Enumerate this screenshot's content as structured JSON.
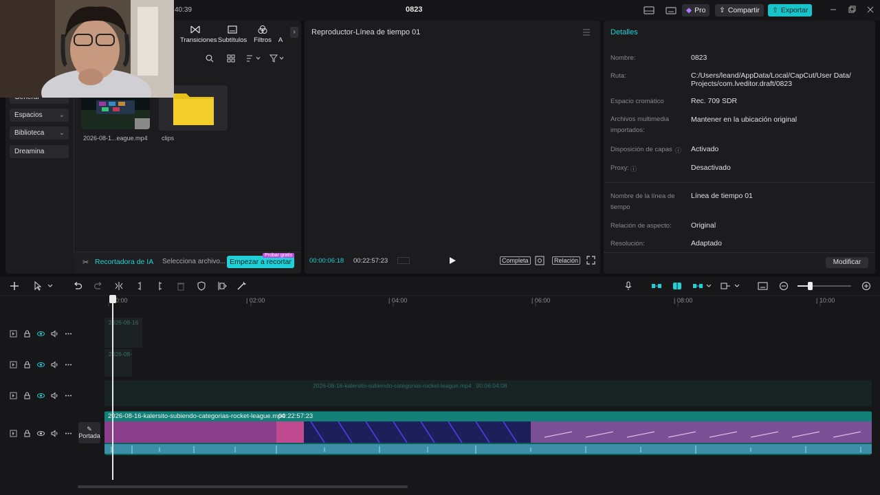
{
  "topbar": {
    "clock": "40:39",
    "project_name": "0823",
    "pro_label": "Pro",
    "share_label": "Compartir",
    "export_label": "Exportar"
  },
  "tools": {
    "tabs": [
      {
        "label": "Transiciones",
        "icon": "transitions-icon"
      },
      {
        "label": "Subtítulos",
        "icon": "subtitles-icon"
      },
      {
        "label": "Filtros",
        "icon": "filters-icon"
      },
      {
        "label": "A",
        "icon": "more-icon"
      }
    ]
  },
  "sidebar": {
    "items": [
      {
        "label": "General"
      },
      {
        "label": "Espacios"
      },
      {
        "label": "Biblioteca"
      },
      {
        "label": "Dreamina"
      }
    ]
  },
  "media": {
    "items": [
      {
        "label": "2026-08-1...eague.mp4"
      },
      {
        "label": "clips"
      }
    ]
  },
  "ai_bar": {
    "title": "Recortadora de IA",
    "select": "Selecciona archivo...",
    "button": "Empezar a recortar",
    "badge": "Probar gratis"
  },
  "player": {
    "title": "Reproductor-Línea de tiempo 01",
    "current_time": "00:00:06:18",
    "total_time": "00:22:57:23",
    "btn_full": "Completa",
    "btn_ratio": "Relación"
  },
  "details": {
    "title": "Detalles",
    "rows": [
      {
        "label": "Nombre:",
        "value": "0823"
      },
      {
        "label": "Ruta:",
        "value": "C:/Users/leand/AppData/Local/CapCut/User Data/ Projects/com.lveditor.draft/0823"
      },
      {
        "label": "Espacio cromático",
        "value": "Rec. 709 SDR"
      },
      {
        "label": "Archivos multimedia importados:",
        "value": "Mantener en la ubicación original"
      },
      {
        "label": "Disposición de capas",
        "value": "Activado"
      },
      {
        "label": "Proxy:",
        "value": "Desactivado"
      },
      {
        "label": "Nombre de la línea de tiempo",
        "value": "Línea de tiempo 01"
      },
      {
        "label": "Relación de aspecto:",
        "value": "Original"
      },
      {
        "label": "Resolución:",
        "value": "Adaptado"
      }
    ],
    "modify_label": "Modificar"
  },
  "timeline": {
    "ruler_labels": [
      "00:00",
      "| 02:00",
      "| 04:00",
      "| 06:00",
      "| 08:00",
      "| 10:00"
    ],
    "cover_label": "Portada",
    "main_clip": {
      "name": "2026-08-16-kalersito-subiendo-categorias-rocket-league.mp4",
      "duration": "00:22:57:23"
    },
    "faded_clip_labels": [
      "2026-08-16",
      "2026-08-",
      "2026-08-16-kalersito-subiendo-categorias-rocket-league.mp4   00:06:04:08"
    ]
  },
  "colors": {
    "accent": "#20d0d6",
    "clip": "#138078",
    "badge": "#c04de0"
  }
}
